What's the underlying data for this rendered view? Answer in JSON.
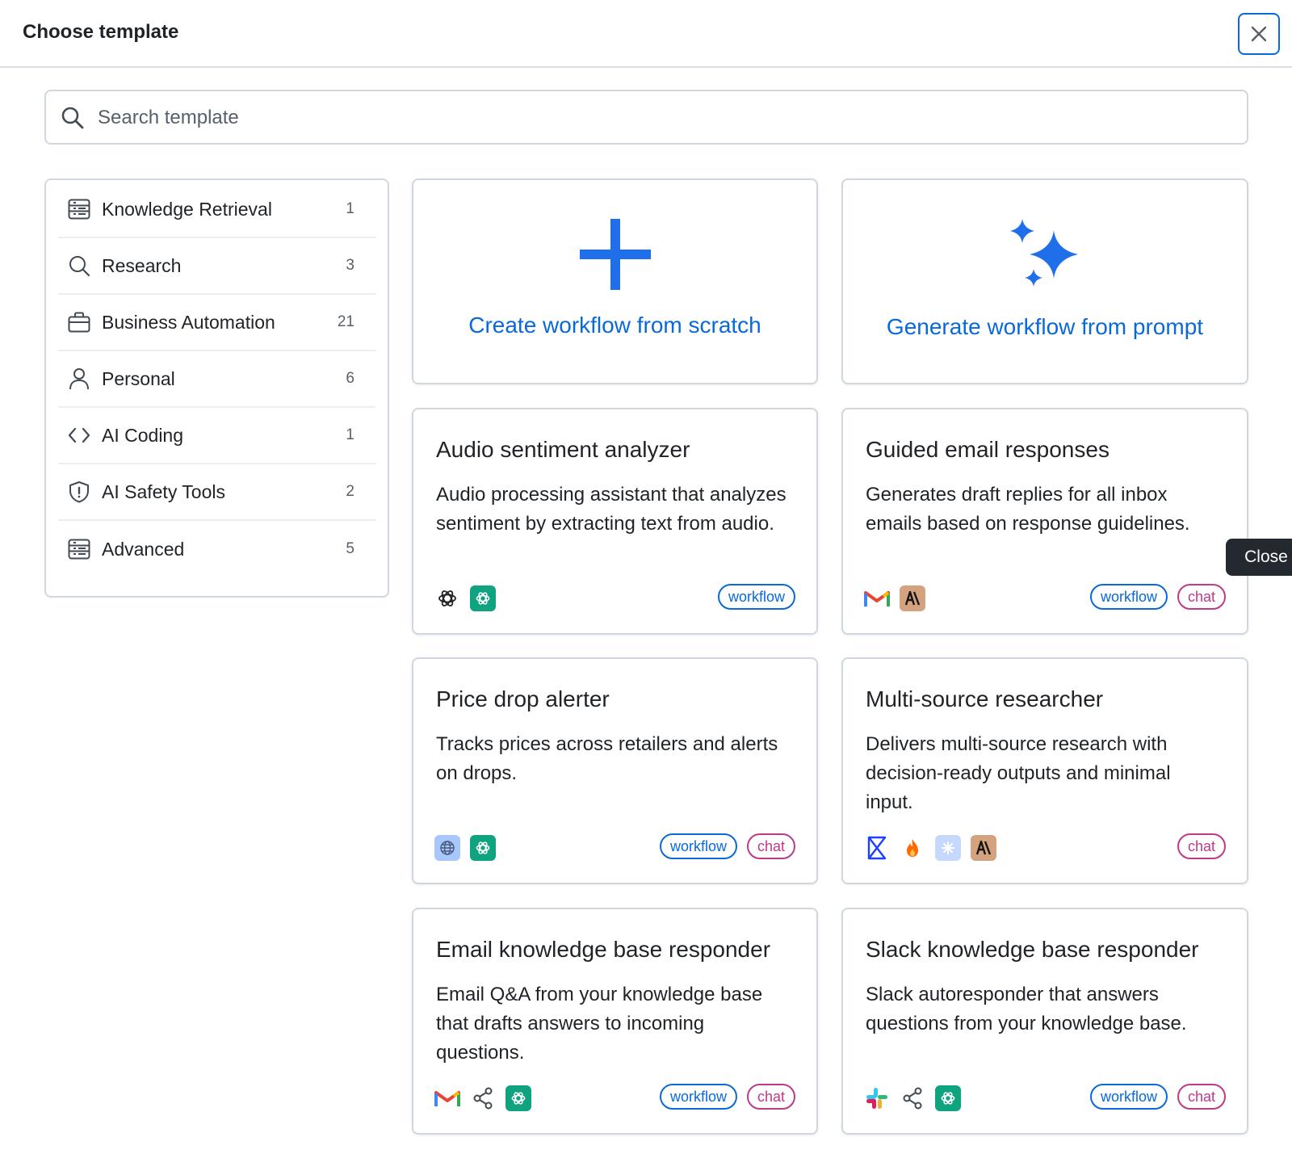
{
  "header": {
    "title": "Choose template"
  },
  "search": {
    "placeholder": "Search template"
  },
  "sidebar": {
    "items": [
      {
        "label": "Knowledge Retrieval",
        "count": "1",
        "icon": "table-icon"
      },
      {
        "label": "Research",
        "count": "3",
        "icon": "search-icon"
      },
      {
        "label": "Business Automation",
        "count": "21",
        "icon": "briefcase-icon"
      },
      {
        "label": "Personal",
        "count": "6",
        "icon": "person-icon"
      },
      {
        "label": "AI Coding",
        "count": "1",
        "icon": "code-icon"
      },
      {
        "label": "AI Safety Tools",
        "count": "2",
        "icon": "shield-icon"
      },
      {
        "label": "Advanced",
        "count": "5",
        "icon": "table-icon"
      }
    ]
  },
  "actions": {
    "scratch_label": "Create workflow from scratch",
    "prompt_label": "Generate workflow from prompt"
  },
  "templates": [
    {
      "title": "Audio sentiment analyzer",
      "description": "Audio processing assistant that analyzes sentiment by extracting text from audio.",
      "icons": [
        "openai-icon",
        "chatgpt-icon"
      ],
      "tags": [
        "workflow"
      ]
    },
    {
      "title": "Guided email responses",
      "description": "Generates draft replies for all inbox emails based on response guidelines.",
      "icons": [
        "gmail-icon",
        "anthropic-icon"
      ],
      "tags": [
        "workflow",
        "chat"
      ]
    },
    {
      "title": "Price drop alerter",
      "description": "Tracks prices across retailers and alerts on drops.",
      "icons": [
        "web-scraper-icon",
        "chatgpt-icon"
      ],
      "tags": [
        "workflow",
        "chat"
      ]
    },
    {
      "title": "Multi-source researcher",
      "description": "Delivers multi-source research with decision-ready outputs and minimal input.",
      "icons": [
        "exa-icon",
        "firecrawl-icon",
        "perplexity-icon",
        "anthropic-icon"
      ],
      "tags": [
        "chat"
      ]
    },
    {
      "title": "Email knowledge base responder",
      "description": "Email Q&A from your knowledge base that drafts answers to incoming questions.",
      "icons": [
        "gmail-icon",
        "share-icon",
        "chatgpt-icon"
      ],
      "tags": [
        "workflow",
        "chat"
      ]
    },
    {
      "title": "Slack knowledge base responder",
      "description": "Slack autoresponder that answers questions from your knowledge base.",
      "icons": [
        "slack-icon",
        "share-icon",
        "chatgpt-icon"
      ],
      "tags": [
        "workflow",
        "chat"
      ]
    }
  ],
  "tags": {
    "workflow": "workflow",
    "chat": "chat"
  },
  "tooltip": {
    "text": "Close"
  },
  "colors": {
    "accent": "#0969da",
    "chat": "#bf3989",
    "chatgpt_green": "#10a37f",
    "anthropic": "#d4a27f"
  }
}
